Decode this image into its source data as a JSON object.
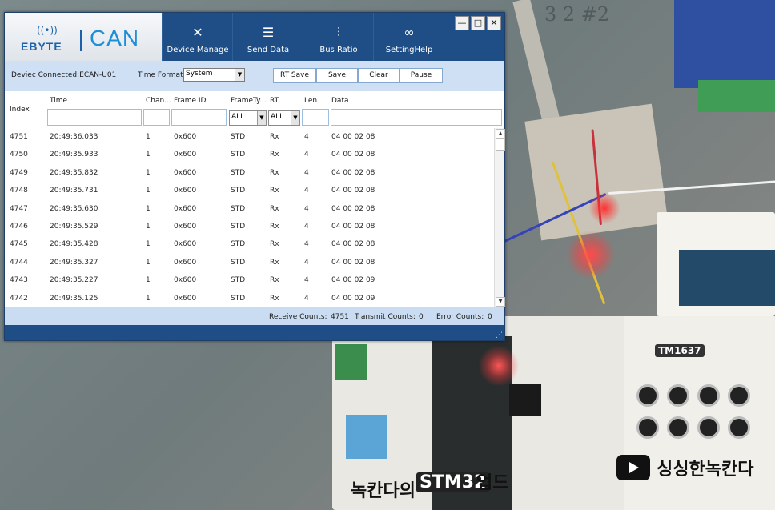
{
  "app": {
    "logo_ebyte": "EBYTE",
    "logo_can": "CAN",
    "nav": [
      {
        "label": "Device Manage",
        "icon": "tools-icon"
      },
      {
        "label": "Send Data",
        "icon": "list-settings-icon"
      },
      {
        "label": "Bus Ratio",
        "icon": "sliders-icon"
      },
      {
        "label": "SettingHelp",
        "icon": "settings-grid-icon"
      }
    ],
    "window_buttons": {
      "minimize": "—",
      "maximize": "□",
      "close": "✕"
    }
  },
  "toolbar": {
    "device_status": "Deviec Connected:ECAN-U01",
    "time_format_label": "Time Format",
    "time_format_value": "System",
    "buttons": [
      "RT Save",
      "Save",
      "Clear",
      "Pause"
    ]
  },
  "grid": {
    "headers": [
      "Index",
      "Time",
      "Chan...",
      "Frame ID",
      "FrameTy...",
      "RT",
      "Len",
      "Data"
    ],
    "filters": {
      "frame_type": "ALL",
      "rt": "ALL"
    },
    "rows": [
      {
        "index": "4751",
        "time": "20:49:36.033",
        "chan": "1",
        "frame_id": "0x600",
        "type": "STD",
        "rt": "Rx",
        "len": "4",
        "data": "04 00 02 08"
      },
      {
        "index": "4750",
        "time": "20:49:35.933",
        "chan": "1",
        "frame_id": "0x600",
        "type": "STD",
        "rt": "Rx",
        "len": "4",
        "data": "04 00 02 08"
      },
      {
        "index": "4749",
        "time": "20:49:35.832",
        "chan": "1",
        "frame_id": "0x600",
        "type": "STD",
        "rt": "Rx",
        "len": "4",
        "data": "04 00 02 08"
      },
      {
        "index": "4748",
        "time": "20:49:35.731",
        "chan": "1",
        "frame_id": "0x600",
        "type": "STD",
        "rt": "Rx",
        "len": "4",
        "data": "04 00 02 08"
      },
      {
        "index": "4747",
        "time": "20:49:35.630",
        "chan": "1",
        "frame_id": "0x600",
        "type": "STD",
        "rt": "Rx",
        "len": "4",
        "data": "04 00 02 08"
      },
      {
        "index": "4746",
        "time": "20:49:35.529",
        "chan": "1",
        "frame_id": "0x600",
        "type": "STD",
        "rt": "Rx",
        "len": "4",
        "data": "04 00 02 08"
      },
      {
        "index": "4745",
        "time": "20:49:35.428",
        "chan": "1",
        "frame_id": "0x600",
        "type": "STD",
        "rt": "Rx",
        "len": "4",
        "data": "04 00 02 08"
      },
      {
        "index": "4744",
        "time": "20:49:35.327",
        "chan": "1",
        "frame_id": "0x600",
        "type": "STD",
        "rt": "Rx",
        "len": "4",
        "data": "04 00 02 08"
      },
      {
        "index": "4743",
        "time": "20:49:35.227",
        "chan": "1",
        "frame_id": "0x600",
        "type": "STD",
        "rt": "Rx",
        "len": "4",
        "data": "04 00 02 09"
      },
      {
        "index": "4742",
        "time": "20:49:35.125",
        "chan": "1",
        "frame_id": "0x600",
        "type": "STD",
        "rt": "Rx",
        "len": "4",
        "data": "04 00 02 09"
      }
    ]
  },
  "status": {
    "receive_label": "Receive Counts:",
    "receive_value": "4751",
    "transmit_label": "Transmit Counts:",
    "transmit_value": "0",
    "error_label": "Error Counts:",
    "error_value": "0"
  },
  "background": {
    "tm_label": "TM1637",
    "korean_text": "싱싱한녹칸다",
    "korean_text2": "녹칸다의",
    "stm_text": "STM32",
    "korean_text3": "업드"
  },
  "colors": {
    "title_blue": "#1f4e86",
    "toolbar_blue": "#cfe0f5",
    "logo_blue": "#1d62a8"
  }
}
